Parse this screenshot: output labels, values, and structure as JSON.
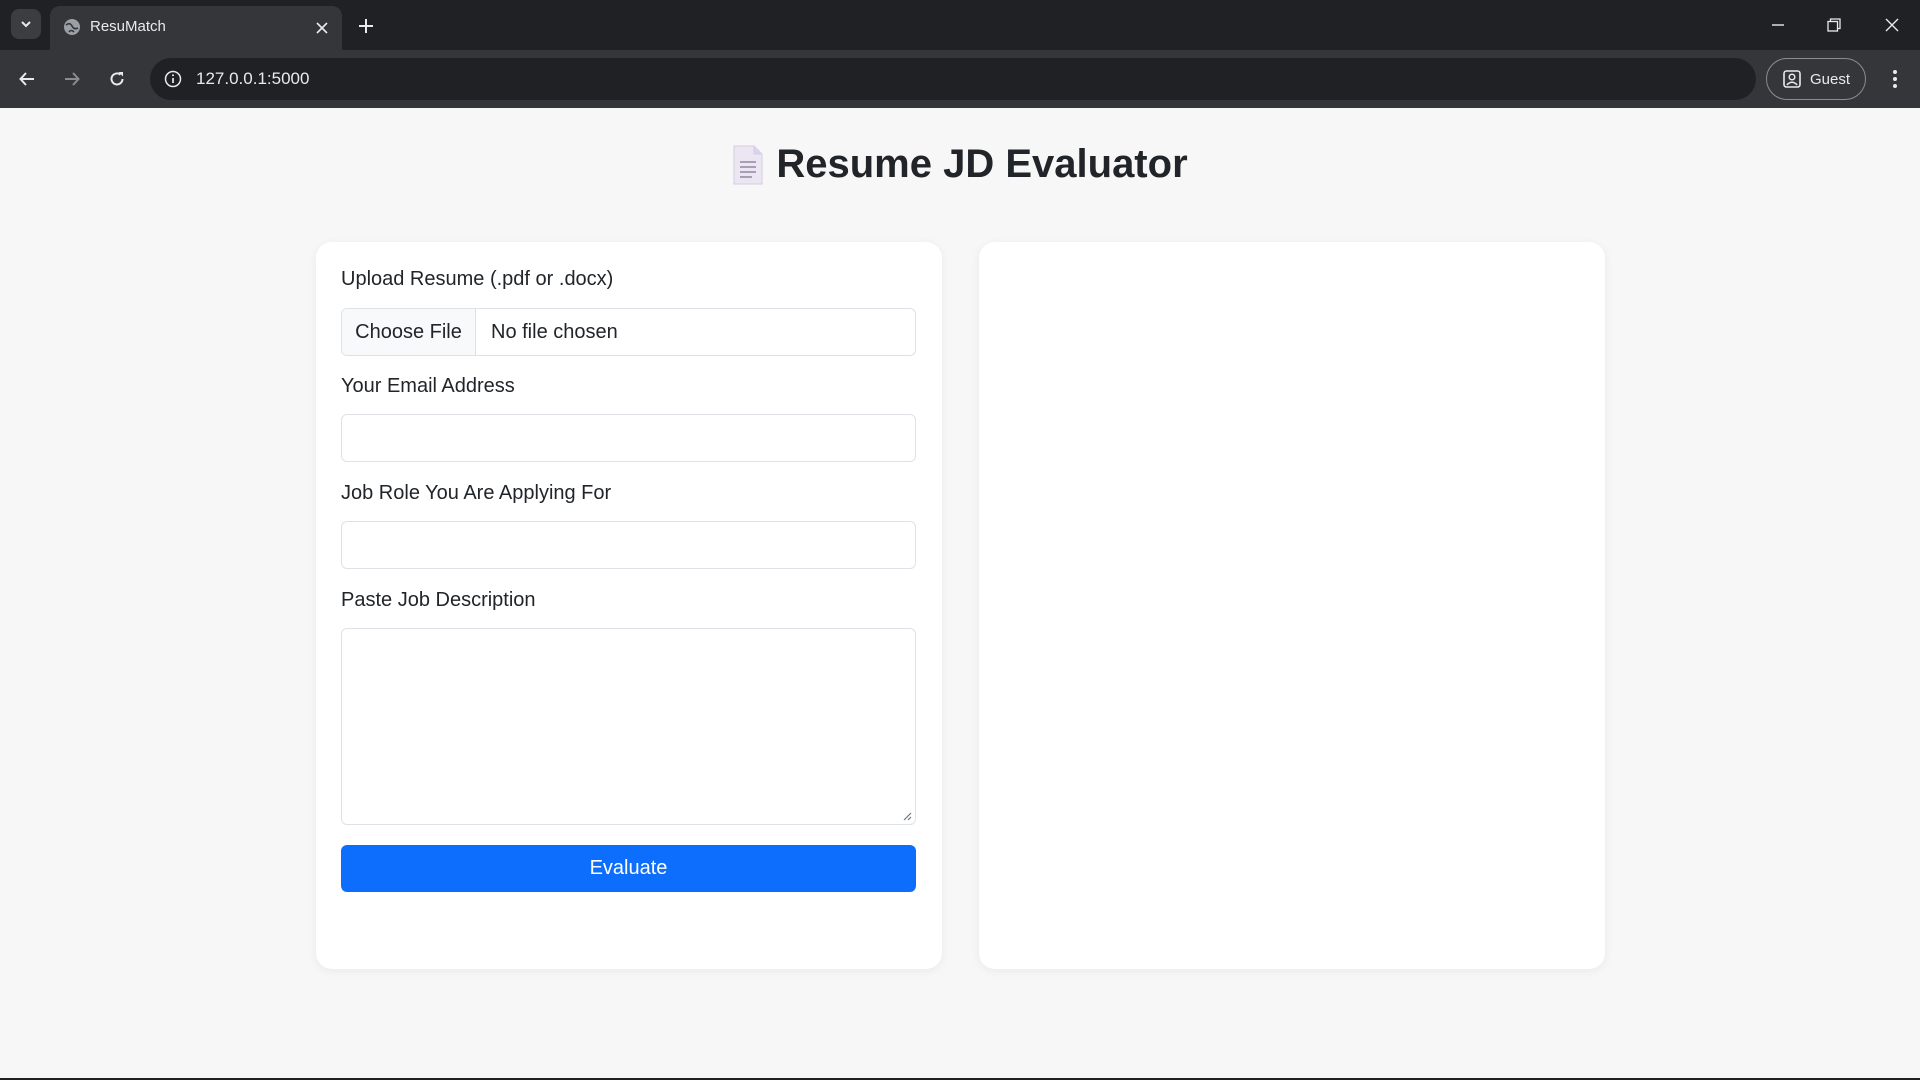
{
  "browser": {
    "tab_title": "ResuMatch",
    "url": "127.0.0.1:5000",
    "profile_label": "Guest"
  },
  "page": {
    "title": "Resume JD Evaluator"
  },
  "form": {
    "resume_label": "Upload Resume (.pdf or .docx)",
    "file_button": "Choose File",
    "file_status": "No file chosen",
    "email_label": "Your Email Address",
    "email_value": "",
    "role_label": "Job Role You Are Applying For",
    "role_value": "",
    "jd_label": "Paste Job Description",
    "jd_value": "",
    "submit_label": "Evaluate"
  },
  "colors": {
    "accent": "#0d6efd",
    "background": "#f7f7f7",
    "card": "#ffffff"
  }
}
